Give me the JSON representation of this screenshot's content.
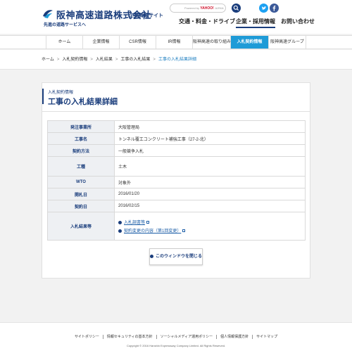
{
  "header": {
    "company_name": "阪神高速道路株式会社",
    "site_name": "企業情報サイト",
    "tagline": "先進の道路サービスへ",
    "search": {
      "powered_by": "Powered by",
      "engine": "YAHOO!",
      "suffix": "JAPAN"
    },
    "global_nav": [
      "交通・料金・ドライブ",
      "企業・採用情報",
      "お問い合わせ"
    ],
    "active_global": "企業・採用情報",
    "colors": {
      "brand": "#1a3d7c",
      "twitter": "#1da1f2",
      "facebook": "#3b5998",
      "accent": "#1e9bd7"
    }
  },
  "subnav": {
    "items": [
      "ホーム",
      "企業情報",
      "CSR情報",
      "IR情報",
      "阪神高速の取り組み",
      "入札契約情報",
      "阪神高速グループ"
    ],
    "active": "入札契約情報"
  },
  "breadcrumb": [
    "ホーム",
    "入札契約情報",
    "入札結果",
    "工事の入札結果",
    "工事の入札結果詳細"
  ],
  "panel": {
    "label": "入札契約情報",
    "title": "工事の入札結果詳細",
    "rows": [
      {
        "label": "発注事業所",
        "value": "大阪管理局"
      },
      {
        "label": "工事名",
        "value": "トンネル覆工コンクリート補強工事（27-2-北）"
      },
      {
        "label": "契約方法",
        "value": "一般競争入札"
      },
      {
        "label": "工種",
        "value": "土木"
      },
      {
        "label": "WTO",
        "value": "対象外"
      },
      {
        "label": "開札日",
        "value": "2016/01/20"
      },
      {
        "label": "契約日",
        "value": "2016/02/15"
      }
    ],
    "documents_label": "入札結果等",
    "documents": [
      "入札調書等",
      "契約変更の内容（第1回変更）"
    ],
    "close_label": "このウィンドウを閉じる"
  },
  "footer": {
    "links": [
      "サイトポリシー",
      "情報セキュリティの基本方針",
      "ソーシャルメディア運用ポリシー",
      "個人情報保護方針",
      "サイトマップ"
    ],
    "copyright": "Copyright © 2016 Hanshin Expressway Company Limited. All Rights Reserved."
  }
}
